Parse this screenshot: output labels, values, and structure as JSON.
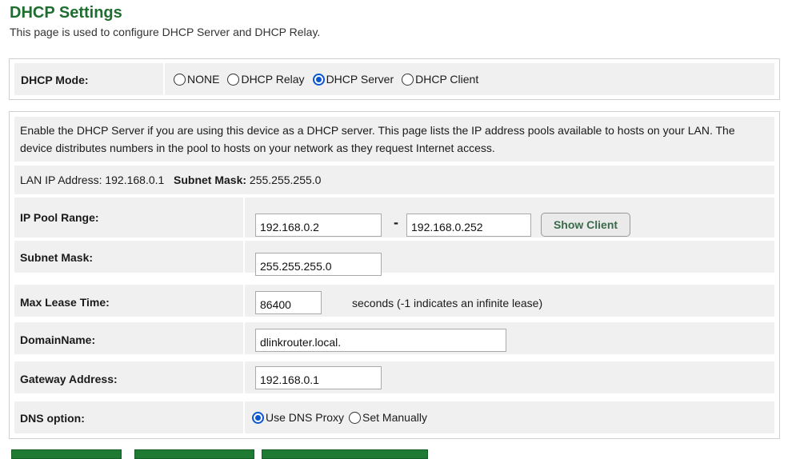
{
  "header": {
    "title": "DHCP Settings",
    "description": "This page is used to configure DHCP Server and DHCP Relay."
  },
  "mode": {
    "label": "DHCP Mode:",
    "options": [
      "NONE",
      "DHCP Relay",
      "DHCP Server",
      "DHCP Client"
    ],
    "selected": "DHCP Server"
  },
  "server": {
    "intro": "Enable the DHCP Server if you are using this device as a DHCP server. This page lists the IP address pools available to hosts on your LAN. The device distributes numbers in the pool to hosts on your network as they request Internet access.",
    "lan_ip_label": "LAN IP Address:",
    "lan_ip_value": "192.168.0.1",
    "subnet_label_inline": "Subnet Mask:",
    "subnet_value_inline": "255.255.255.0",
    "pool_label": "IP Pool Range:",
    "pool_start": "192.168.0.2",
    "pool_dash": "-",
    "pool_end": "192.168.0.252",
    "show_client_label": "Show Client",
    "subnet_label": "Subnet Mask:",
    "subnet_value": "255.255.255.0",
    "lease_label": "Max Lease Time:",
    "lease_value": "86400",
    "lease_note": "seconds (-1 indicates an infinite lease)",
    "domain_label": "DomainName:",
    "domain_value": "dlinkrouter.local.",
    "gateway_label": "Gateway Address:",
    "gateway_value": "192.168.0.1",
    "dns_label": "DNS option:",
    "dns_options": [
      "Use DNS Proxy",
      "Set Manually"
    ],
    "dns_selected": "Use DNS Proxy"
  },
  "colors": {
    "title": "#1e6e2f",
    "radio_selected": "#0b57d0",
    "button_bg": "#1f7a34"
  }
}
